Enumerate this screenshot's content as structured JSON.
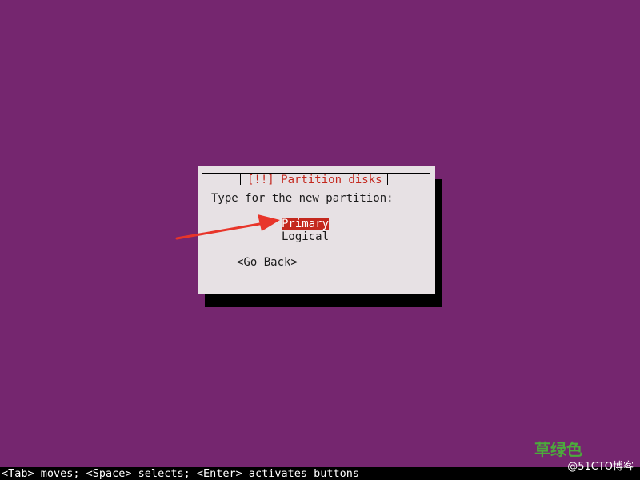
{
  "dialog": {
    "title": "[!!] Partition disks",
    "prompt": "Type for the new partition:",
    "options": [
      {
        "label": "Primary",
        "selected": true
      },
      {
        "label": "Logical",
        "selected": false
      }
    ],
    "go_back_label": "<Go Back>"
  },
  "status_bar": {
    "text": "<Tab> moves; <Space> selects; <Enter> activates buttons"
  },
  "watermark": {
    "main": "草绿色",
    "sub": "@51CTO博客"
  },
  "colors": {
    "background": "#75266f",
    "dialog": "#e7e1e4",
    "accent": "#c4281e",
    "annotation_arrow": "#e8352a"
  }
}
